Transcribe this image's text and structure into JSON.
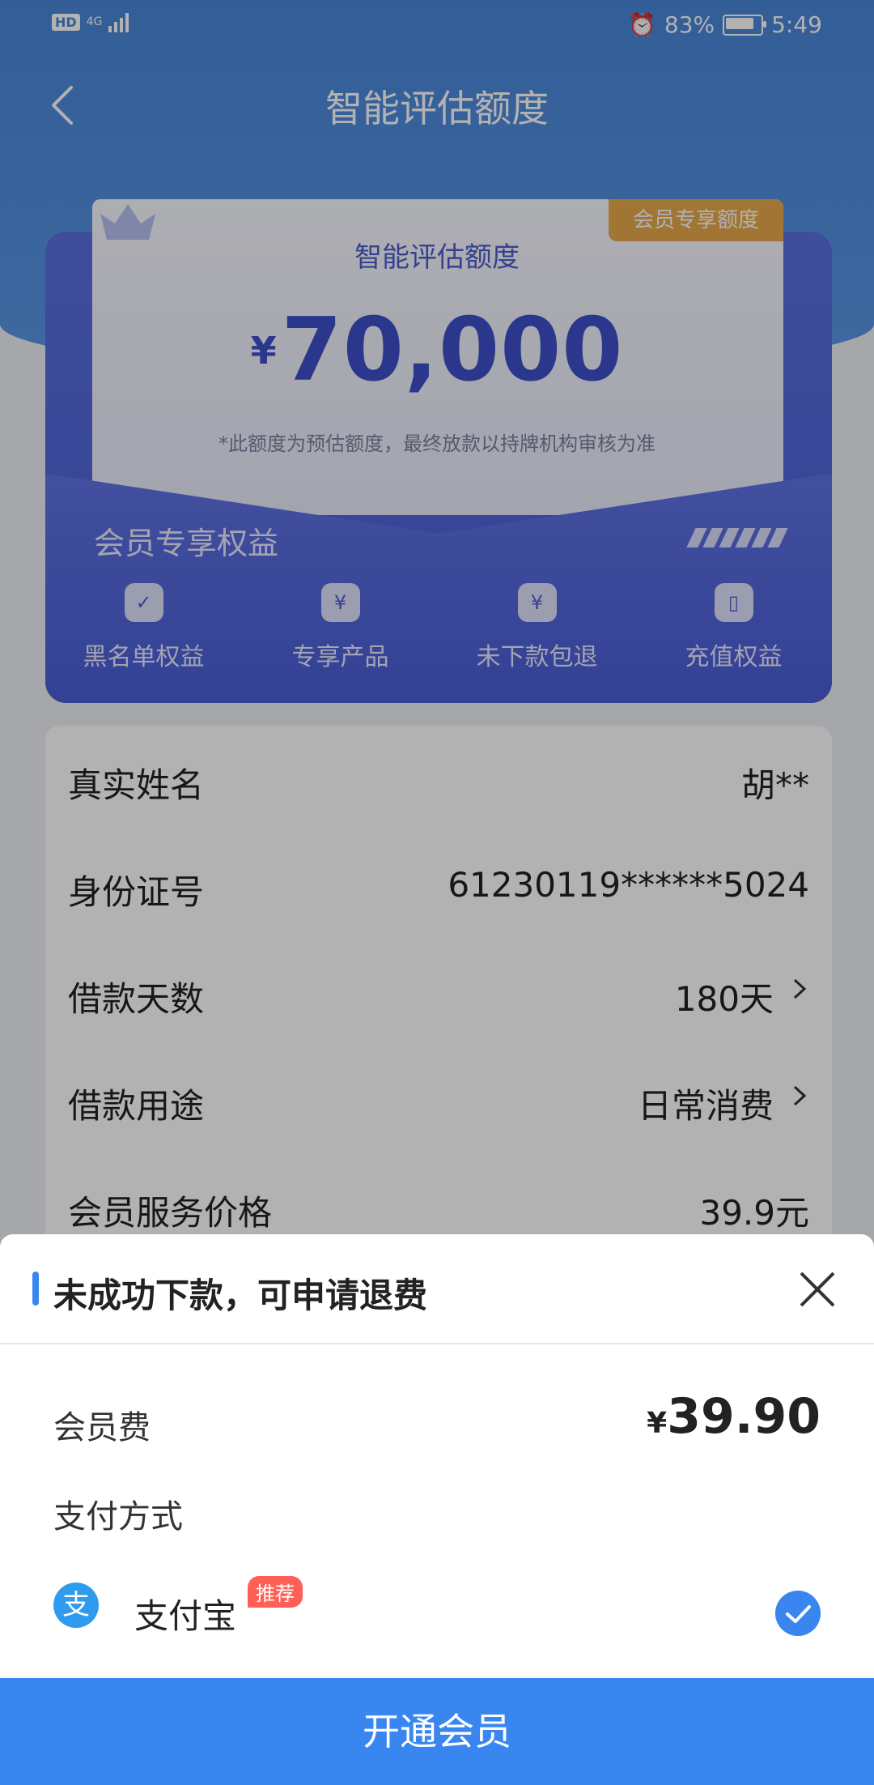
{
  "status_bar": {
    "network": "4G",
    "battery": "83%",
    "time": "5:49"
  },
  "nav": {
    "title": "智能评估额度"
  },
  "card": {
    "tag": "会员专享额度",
    "title": "智能评估额度",
    "currency": "¥",
    "amount": "70,000",
    "note": "*此额度为预估额度，最终放款以持牌机构审核为准",
    "benefits_title": "会员专享权益",
    "benefits": [
      {
        "label": "黑名单权益",
        "icon": "user-check-icon"
      },
      {
        "label": "专享产品",
        "icon": "money-bag-icon"
      },
      {
        "label": "未下款包退",
        "icon": "shield-yen-icon"
      },
      {
        "label": "充值权益",
        "icon": "phone-icon"
      }
    ]
  },
  "info": {
    "rows": [
      {
        "label": "真实姓名",
        "value": "胡**"
      },
      {
        "label": "身份证号",
        "value": "61230119******5024"
      },
      {
        "label": "借款天数",
        "value": "180天"
      },
      {
        "label": "借款用途",
        "value": "日常消费"
      },
      {
        "label": "会员服务价格",
        "value": "39.9元"
      }
    ]
  },
  "sheet": {
    "title": "未成功下款，可申请退费",
    "fee_label": "会员费",
    "fee_currency": "¥",
    "fee_amount": "39.90",
    "pay_label": "支付方式",
    "alipay_glyph": "支",
    "alipay_name": "支付宝",
    "recommend_badge": "推荐",
    "cta_label": "开通会员"
  },
  "colors": {
    "primary": "#3a86f1",
    "card": "#4b5ed6",
    "tag": "#e7a642",
    "badge": "#ff5f55"
  }
}
